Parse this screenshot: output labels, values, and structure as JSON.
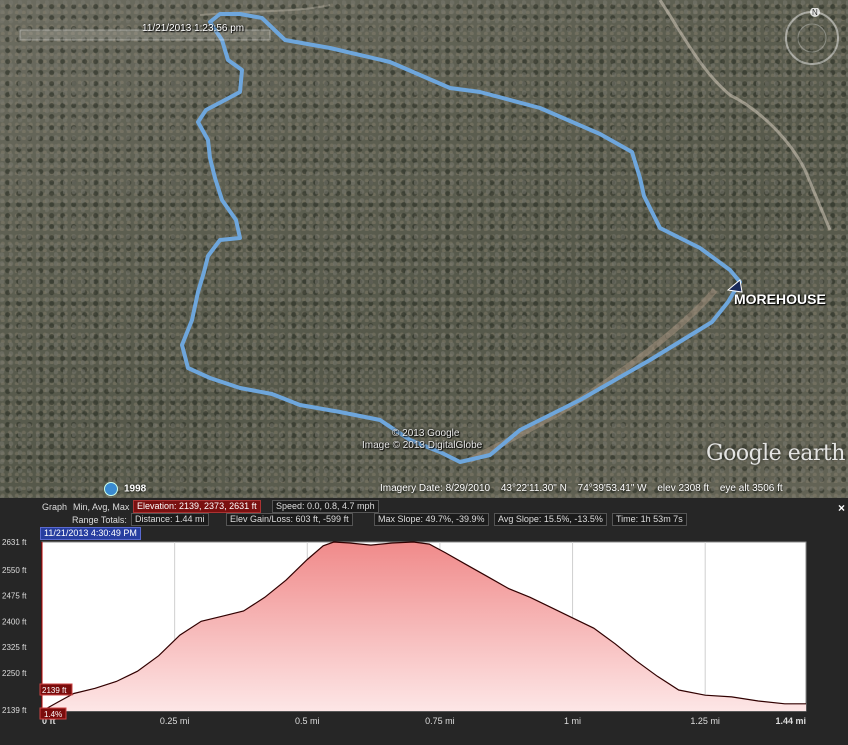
{
  "map": {
    "time_slider_label": "11/21/2013  1:23:56 pm",
    "placemark_label": "MOREHOUSE",
    "copyright": [
      "© 2013 Google",
      "Image © 2013 DigitalGlobe"
    ],
    "historical_year": "1998",
    "status": {
      "imagery_date": "Imagery Date: 8/29/2010",
      "lat": "43°22'11.30\" N",
      "lon": "74°39'53.41\" W",
      "elev": "elev  2308 ft",
      "eye_alt": "eye alt  3506 ft"
    },
    "logo": "Google earth",
    "compass_label": "N",
    "track_color": "#6ea6dc",
    "colors": {
      "track": "#6ea6dc"
    }
  },
  "profile": {
    "graph_label": "Graph",
    "graph_mode": "Min, Avg, Max",
    "elevation_stats": "Elevation: 2139, 2373, 2631 ft",
    "speed_stats": "Speed: 0.0, 0.8, 4.7 mph",
    "range_totals_label": "Range Totals:",
    "distance": "Distance: 1.44 mi",
    "gain_loss": "Elev Gain/Loss: 603 ft, -599 ft",
    "max_slope": "Max Slope: 49.7%, -39.9%",
    "avg_slope": "Avg Slope: 15.5%, -13.5%",
    "time": "Time: 1h 53m 7s",
    "cursor_time": "11/21/2013 4:30:49 PM",
    "cursor_elev": "2139 ft",
    "cursor_slope": "1.4%",
    "close_glyph": "×"
  },
  "chart_data": {
    "type": "area",
    "x_unit": "mi",
    "y_unit": "ft",
    "x_ticks": [
      "0 ft",
      "0.25 mi",
      "0.5 mi",
      "0.75 mi",
      "1 mi",
      "1.25 mi",
      "1.44 mi"
    ],
    "x_tick_values": [
      0,
      0.25,
      0.5,
      0.75,
      1.0,
      1.25,
      1.44
    ],
    "y_ticks": [
      "2139 ft",
      "2250 ft",
      "2325 ft",
      "2400 ft",
      "2475 ft",
      "2550 ft",
      "2631 ft"
    ],
    "y_tick_values": [
      2139,
      2250,
      2325,
      2400,
      2475,
      2550,
      2631
    ],
    "xlim": [
      0,
      1.44
    ],
    "ylim": [
      2139,
      2631
    ],
    "grid": true,
    "fill_color": "#f2aaaa",
    "line_color": "#300000",
    "x": [
      0,
      0.03,
      0.06,
      0.1,
      0.14,
      0.18,
      0.22,
      0.26,
      0.3,
      0.34,
      0.38,
      0.42,
      0.46,
      0.5,
      0.53,
      0.55,
      0.58,
      0.62,
      0.66,
      0.7,
      0.73,
      0.76,
      0.8,
      0.84,
      0.88,
      0.92,
      0.96,
      1.0,
      1.04,
      1.08,
      1.12,
      1.16,
      1.2,
      1.25,
      1.3,
      1.35,
      1.4,
      1.44
    ],
    "y": [
      2139,
      2165,
      2190,
      2205,
      2225,
      2255,
      2300,
      2360,
      2400,
      2415,
      2430,
      2470,
      2520,
      2580,
      2620,
      2631,
      2628,
      2622,
      2628,
      2631,
      2625,
      2600,
      2565,
      2530,
      2495,
      2470,
      2440,
      2410,
      2380,
      2335,
      2285,
      2240,
      2200,
      2185,
      2180,
      2168,
      2160,
      2160
    ]
  }
}
